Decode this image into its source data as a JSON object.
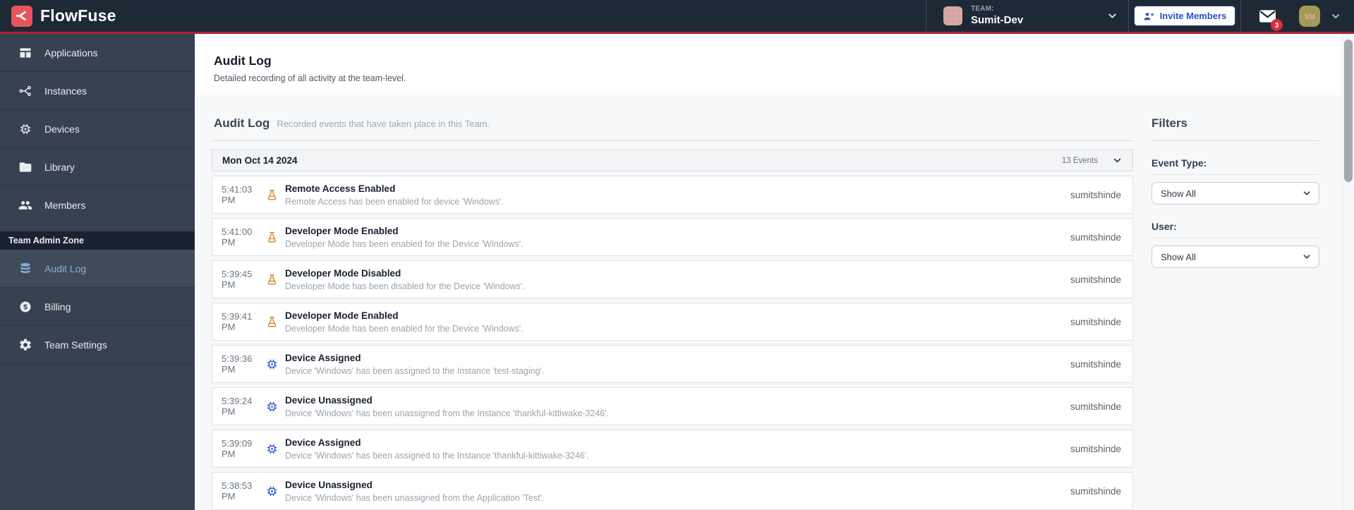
{
  "colors": {
    "navbar_bg": "#1E2936",
    "sidebar_bg": "#374151",
    "brand_red": "#E8545C",
    "accent_line_red": "#AD2038",
    "active_item_blue": "#84AFD6",
    "flask_icon_orange": "#CE8422",
    "chip_icon_blue": "#3056D6",
    "badge_red": "#DF2B3A",
    "invite_blue": "#2B50C7"
  },
  "navbar": {
    "brand": "FlowFuse",
    "team": {
      "label": "TEAM:",
      "name": "Sumit-Dev"
    },
    "invite_button_label": "Invite Members",
    "notifications_badge": "3",
    "user_initials": "su"
  },
  "sidebar": {
    "items": [
      {
        "label": "Applications",
        "icon": "applications-icon"
      },
      {
        "label": "Instances",
        "icon": "instances-icon"
      },
      {
        "label": "Devices",
        "icon": "devices-icon"
      },
      {
        "label": "Library",
        "icon": "library-icon"
      },
      {
        "label": "Members",
        "icon": "members-icon"
      }
    ],
    "admin_zone_label": "Team Admin Zone",
    "admin_items": [
      {
        "label": "Audit Log",
        "icon": "audit-log-icon",
        "active": true
      },
      {
        "label": "Billing",
        "icon": "billing-icon",
        "active": false
      },
      {
        "label": "Team Settings",
        "icon": "team-settings-icon",
        "active": false
      }
    ]
  },
  "page_header": {
    "title": "Audit Log",
    "subtitle": "Detailed recording of all activity at the team-level."
  },
  "audit": {
    "section_title": "Audit Log",
    "section_subtitle": "Recorded events that have taken place in this Team.",
    "group": {
      "date": "Mon Oct 14 2024",
      "events_count": "13 Events"
    },
    "events": [
      {
        "time": "5:41:03 PM",
        "icon": "flask-icon",
        "title": "Remote Access Enabled",
        "description": "Remote Access has been enabled for device 'Windows'.",
        "user": "sumitshinde"
      },
      {
        "time": "5:41:00 PM",
        "icon": "flask-icon",
        "title": "Developer Mode Enabled",
        "description": "Developer Mode has been enabled for the Device 'Windows'.",
        "user": "sumitshinde"
      },
      {
        "time": "5:39:45 PM",
        "icon": "flask-icon",
        "title": "Developer Mode Disabled",
        "description": "Developer Mode has been disabled for the Device 'Windows'.",
        "user": "sumitshinde"
      },
      {
        "time": "5:39:41 PM",
        "icon": "flask-icon",
        "title": "Developer Mode Enabled",
        "description": "Developer Mode has been enabled for the Device 'Windows'.",
        "user": "sumitshinde"
      },
      {
        "time": "5:39:36 PM",
        "icon": "chip-icon",
        "title": "Device Assigned",
        "description": "Device 'Windows' has been assigned to the Instance 'test-staging'.",
        "user": "sumitshinde"
      },
      {
        "time": "5:39:24 PM",
        "icon": "chip-icon",
        "title": "Device Unassigned",
        "description": "Device 'Windows' has been unassigned from the Instance 'thankful-kittiwake-3246'.",
        "user": "sumitshinde"
      },
      {
        "time": "5:39:09 PM",
        "icon": "chip-icon",
        "title": "Device Assigned",
        "description": "Device 'Windows' has been assigned to the Instance 'thankful-kittiwake-3246'.",
        "user": "sumitshinde"
      },
      {
        "time": "5:38:53 PM",
        "icon": "chip-icon",
        "title": "Device Unassigned",
        "description": "Device 'Windows' has been unassigned from the Application 'Test'.",
        "user": "sumitshinde"
      }
    ]
  },
  "filters": {
    "title": "Filters",
    "event_type_label": "Event Type:",
    "event_type_value": "Show All",
    "user_label": "User:",
    "user_value": "Show All"
  }
}
